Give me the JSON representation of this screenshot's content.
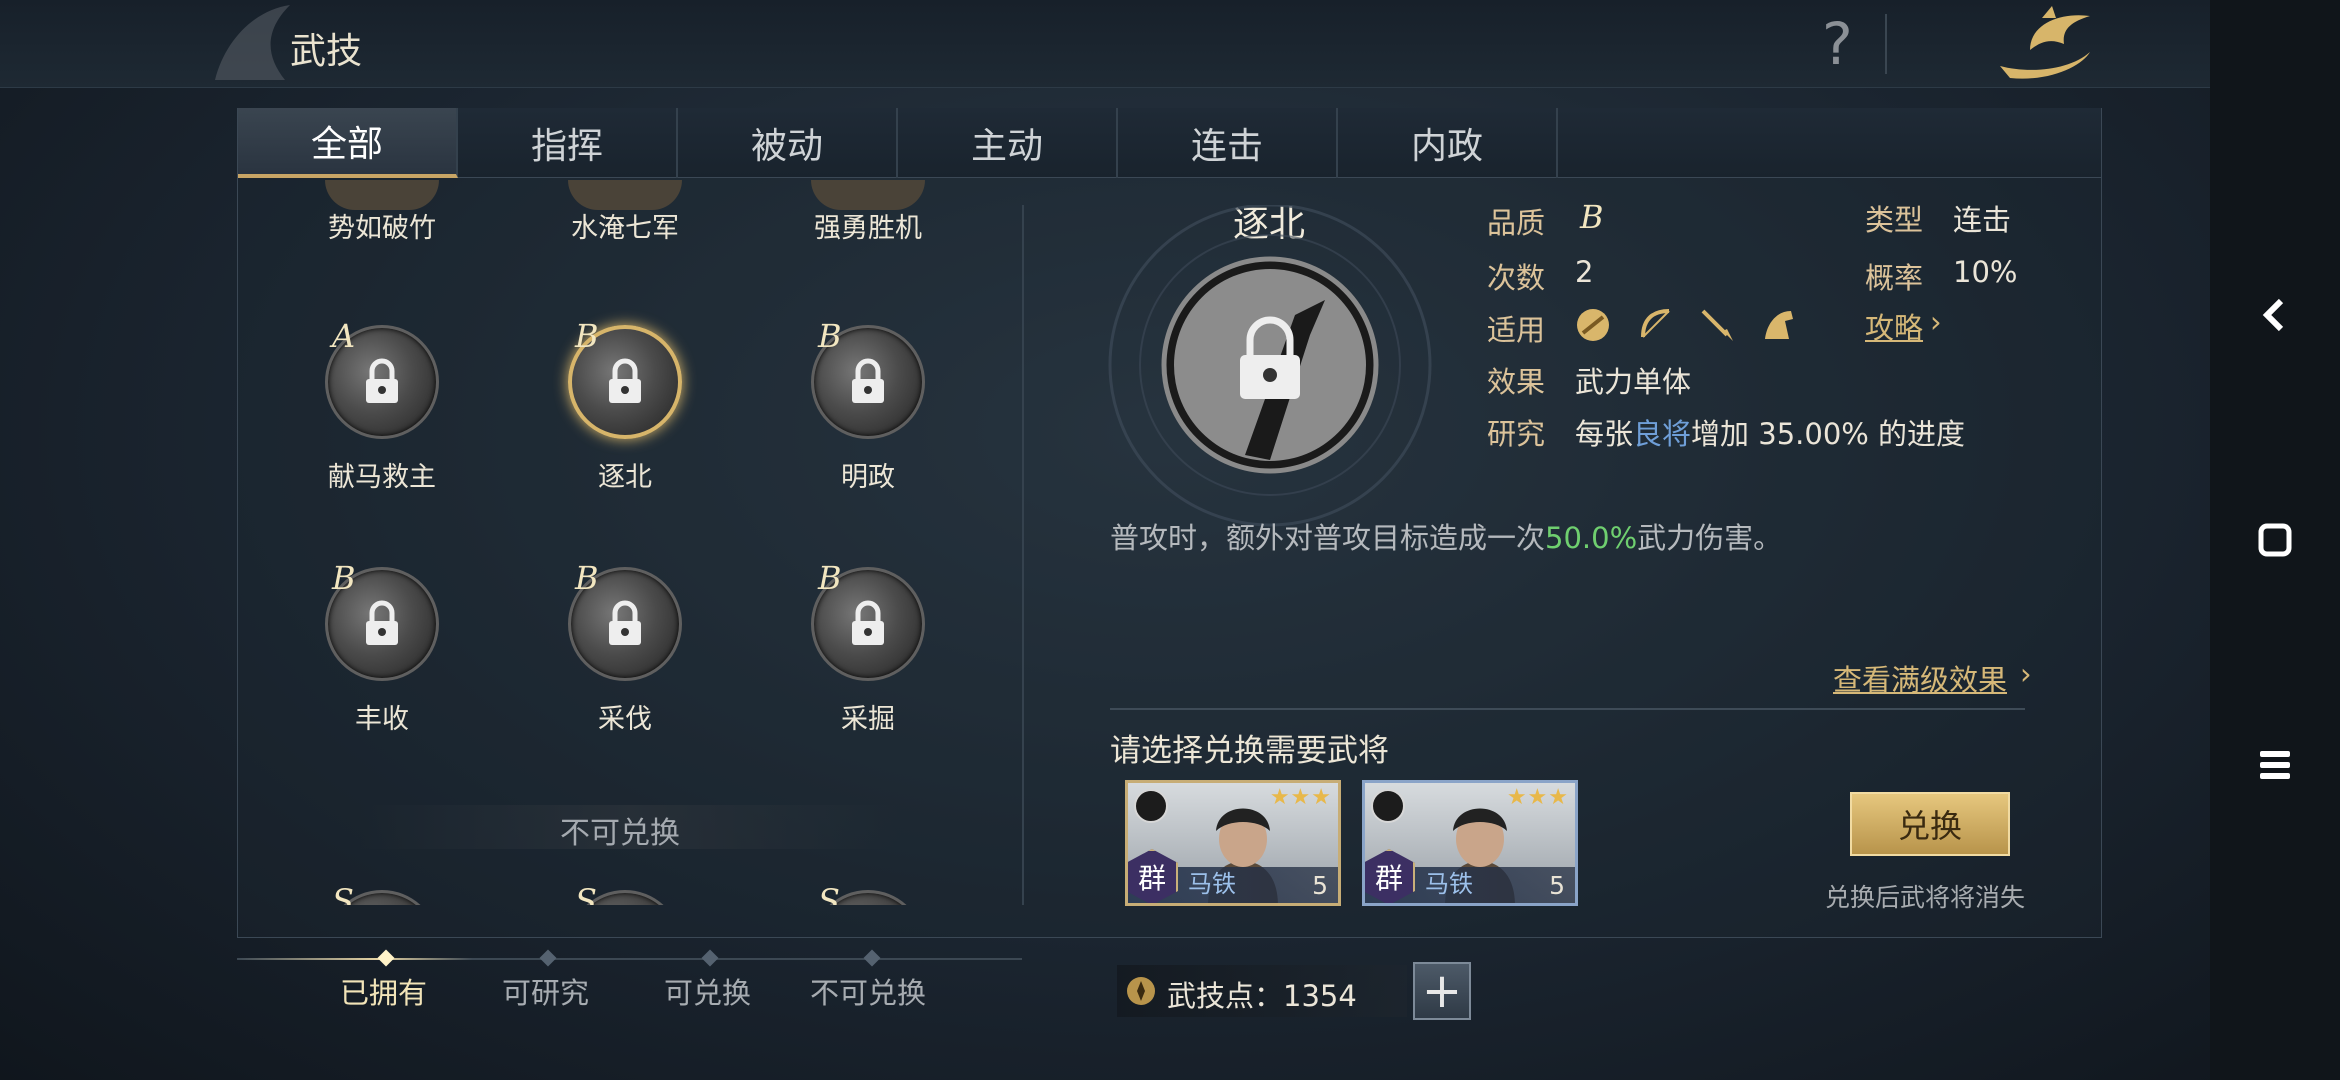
{
  "header": {
    "title": "武技",
    "help_label": "?"
  },
  "tabs": [
    {
      "label": "全部",
      "active": true
    },
    {
      "label": "指挥",
      "active": false
    },
    {
      "label": "被动",
      "active": false
    },
    {
      "label": "主动",
      "active": false
    },
    {
      "label": "连击",
      "active": false
    },
    {
      "label": "内政",
      "active": false
    }
  ],
  "skills_partial_top": [
    "势如破竹",
    "水淹七军",
    "强勇胜机"
  ],
  "skills": [
    {
      "grade": "A",
      "name": "献马救主",
      "selected": false
    },
    {
      "grade": "B",
      "name": "逐北",
      "selected": true
    },
    {
      "grade": "B",
      "name": "明政",
      "selected": false
    },
    {
      "grade": "B",
      "name": "丰收",
      "selected": false
    },
    {
      "grade": "B",
      "name": "采伐",
      "selected": false
    },
    {
      "grade": "B",
      "name": "采掘",
      "selected": false
    }
  ],
  "section_nonexchangeable": "不可兑换",
  "skills_partial_bottom": [
    "S",
    "S",
    "S"
  ],
  "bottom_tabs": [
    {
      "label": "已拥有",
      "active": true
    },
    {
      "label": "可研究",
      "active": false
    },
    {
      "label": "可兑换",
      "active": false
    },
    {
      "label": "不可兑换",
      "active": false
    }
  ],
  "detail": {
    "name": "逐北",
    "quality_label": "品质",
    "quality_value": "B",
    "type_label": "类型",
    "type_value": "连击",
    "count_label": "次数",
    "count_value": "2",
    "rate_label": "概率",
    "rate_value": "10%",
    "apply_label": "适用",
    "apply_icons": [
      "shield-icon",
      "bow-icon",
      "spear-icon",
      "horse-icon"
    ],
    "guide_link": "攻略",
    "effect_label": "效果",
    "effect_value": "武力单体",
    "research_label": "研究",
    "research_prefix": "每张",
    "research_highlight": "良将",
    "research_suffix": "增加 35.00% 的进度",
    "desc_prefix": "普攻时，额外对普攻目标造成一次",
    "desc_value": "50.0%",
    "desc_suffix": "武力伤害。",
    "max_effect_link": "查看满级效果",
    "choose_label": "请选择兑换需要武将"
  },
  "generals": [
    {
      "name": "马铁",
      "level": "5",
      "faction": "群",
      "stars": "★★★",
      "selected": true
    },
    {
      "name": "马铁",
      "level": "5",
      "faction": "群",
      "stars": "★★★",
      "selected": false
    }
  ],
  "exchange": {
    "button": "兑换",
    "note": "兑换后武将将消失"
  },
  "points": {
    "label": "武技点：",
    "value": "1354",
    "plus": "+"
  },
  "colors": {
    "accent_gold": "#d6b878",
    "highlight_green": "#6fcf6f",
    "highlight_blue": "#6f9fd8"
  }
}
